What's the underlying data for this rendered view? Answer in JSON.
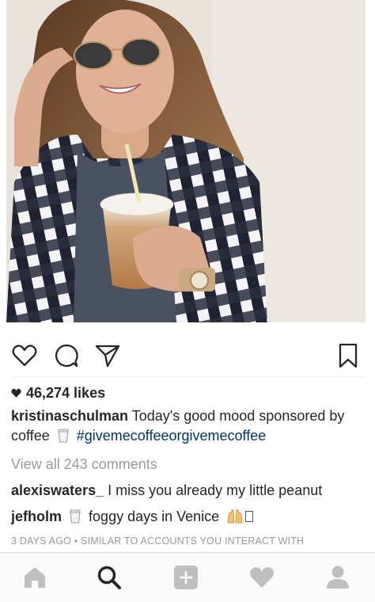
{
  "post": {
    "likes_count": "46,274 likes",
    "caption": {
      "username": "kristinaschulman",
      "text_part1": "Today's good mood sponsored by coffee",
      "hashtag": "#givemecoffeeorgivemecoffee"
    },
    "view_all": "View all 243 comments",
    "comments": [
      {
        "username": "alexiswaters_",
        "text": "I miss you already my little peanut"
      },
      {
        "username": "jefholm",
        "text": "foggy days in Venice"
      }
    ],
    "timestamp": "3 DAYS AGO",
    "similar": "SIMILAR TO ACCOUNTS YOU INTERACT WITH",
    "separator": "•"
  },
  "icons": {
    "like": "heart-outline-icon",
    "comment": "comment-bubble-icon",
    "share": "paper-plane-icon",
    "save": "bookmark-icon",
    "likes_heart": "heart-filled-icon"
  },
  "nav": [
    {
      "name": "home",
      "icon": "home-icon"
    },
    {
      "name": "search",
      "icon": "search-icon",
      "active": true
    },
    {
      "name": "add",
      "icon": "plus-square-icon"
    },
    {
      "name": "activity",
      "icon": "heart-icon"
    },
    {
      "name": "profile",
      "icon": "person-icon"
    }
  ],
  "colors": {
    "hashtag": "#003569",
    "muted": "#999999",
    "nav_inactive": "#bfbfbf",
    "nav_active": "#262626"
  }
}
